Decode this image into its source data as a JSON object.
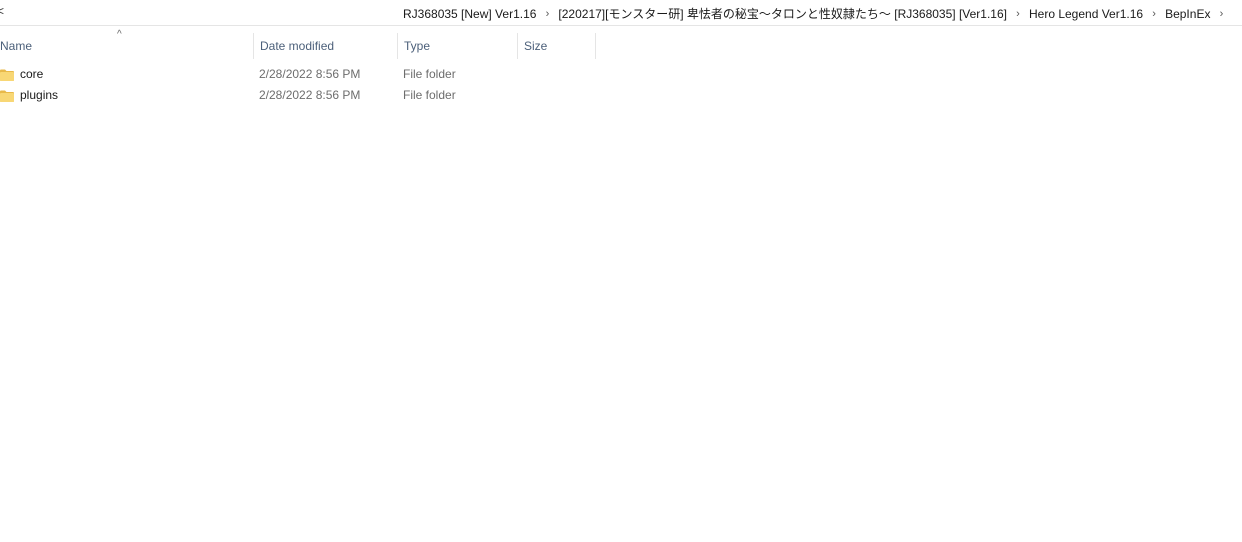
{
  "nav": {
    "left_glyph": "<"
  },
  "breadcrumb": {
    "items": [
      "RJ368035 [New] Ver1.16",
      "[220217][モンスター研] 卑怯者の秘宝～タロンと性奴隷たち～ [RJ368035] [Ver1.16]",
      "Hero Legend Ver1.16",
      "BepInEx"
    ],
    "separator": "›"
  },
  "columns": {
    "name": "Name",
    "date_modified": "Date modified",
    "type": "Type",
    "size": "Size",
    "sort_indicator": "^"
  },
  "files": [
    {
      "name": "core",
      "date_modified": "2/28/2022 8:56 PM",
      "type": "File folder",
      "icon": "folder-icon"
    },
    {
      "name": "plugins",
      "date_modified": "2/28/2022 8:56 PM",
      "type": "File folder",
      "icon": "folder-icon"
    }
  ],
  "colors": {
    "folder_fill": "#f8d775",
    "folder_tab": "#e8b94a",
    "header_text": "#4c607a"
  }
}
